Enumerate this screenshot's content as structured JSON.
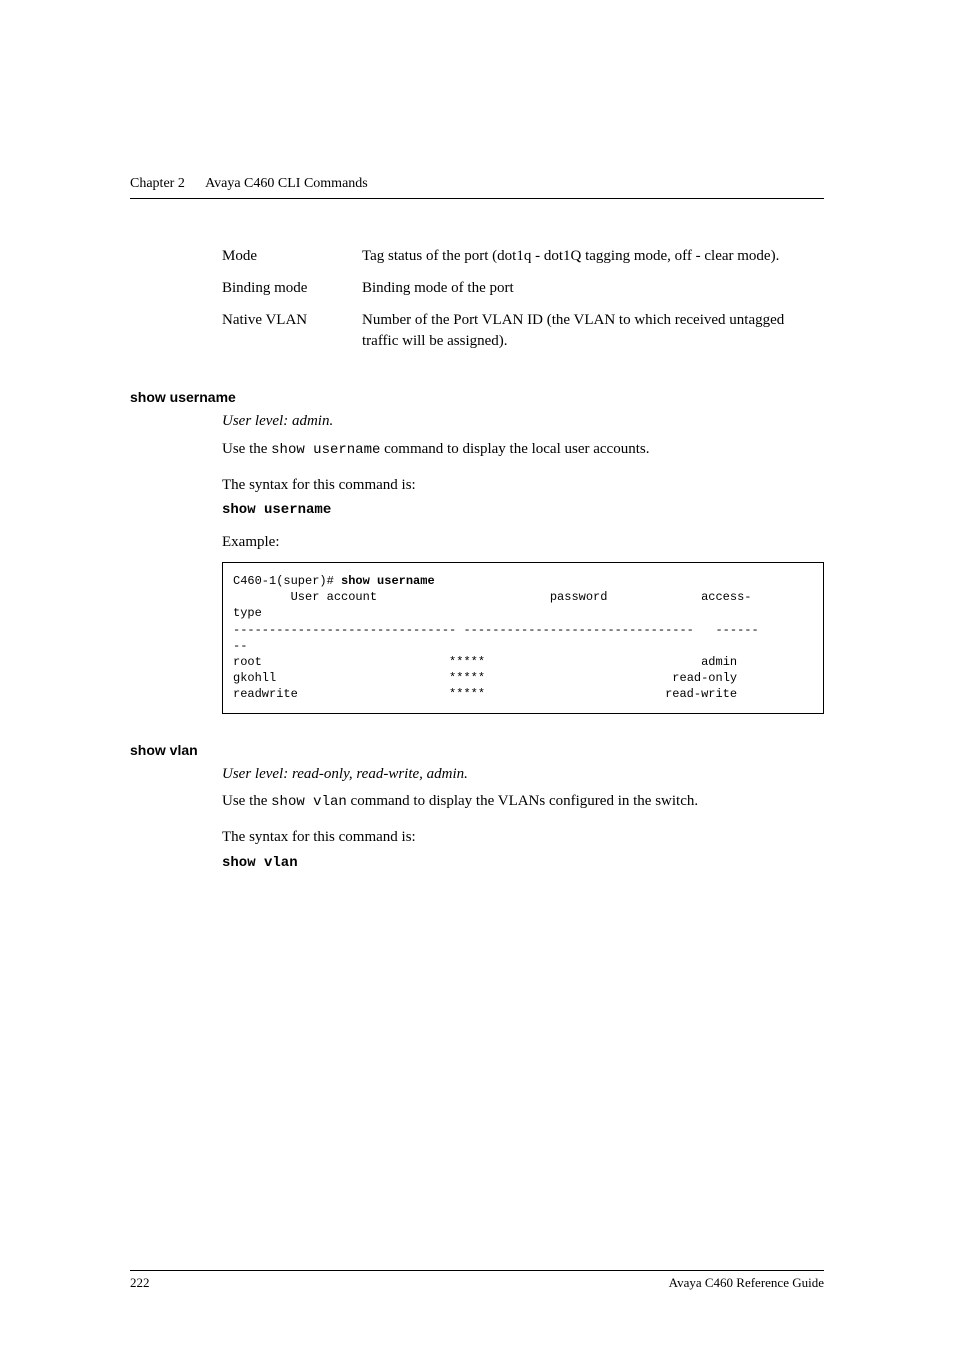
{
  "header": {
    "chapter_label": "Chapter 2",
    "chapter_title": "Avaya C460 CLI Commands"
  },
  "port_defs": [
    {
      "term": "Mode",
      "desc": "Tag status of the port (dot1q - dot1Q tagging mode, off - clear mode)."
    },
    {
      "term": "Binding mode",
      "desc": "Binding mode of the port"
    },
    {
      "term": "Native VLAN",
      "desc": "Number of the Port VLAN ID (the VLAN to which received untagged traffic will be assigned)."
    }
  ],
  "show_username": {
    "heading": "show username",
    "user_level": "User level: admin.",
    "desc_pre": "Use the ",
    "desc_cmd": "show username",
    "desc_post": " command to display the local user accounts.",
    "syntax_label": "The syntax for this command is:",
    "syntax_cmd": "show username",
    "example_label": "Example:",
    "example": {
      "prompt": "C460-1(super)# ",
      "bold_cmd": "show username",
      "header_line": "        User account                        password             access-",
      "type_line": "type",
      "sep_line": "------------------------------- --------------------------------   ------",
      "dash2": "--",
      "rows": [
        {
          "name": "root",
          "pw": "                          *****",
          "type": "                              admin"
        },
        {
          "name": "gkohll",
          "pw": "                        *****",
          "type": "                          read-only"
        },
        {
          "name": "readwrite",
          "pw": "                     *****",
          "type": "                         read-write"
        }
      ]
    }
  },
  "show_vlan": {
    "heading": "show vlan",
    "user_level": "User level: read-only, read-write, admin.",
    "desc_pre": "Use the ",
    "desc_cmd": "show vlan",
    "desc_post": " command to display the VLANs configured in the switch.",
    "syntax_label": "The syntax for this command is:",
    "syntax_cmd": "show vlan"
  },
  "footer": {
    "page_number": "222",
    "doc_title": "Avaya C460 Reference Guide"
  }
}
